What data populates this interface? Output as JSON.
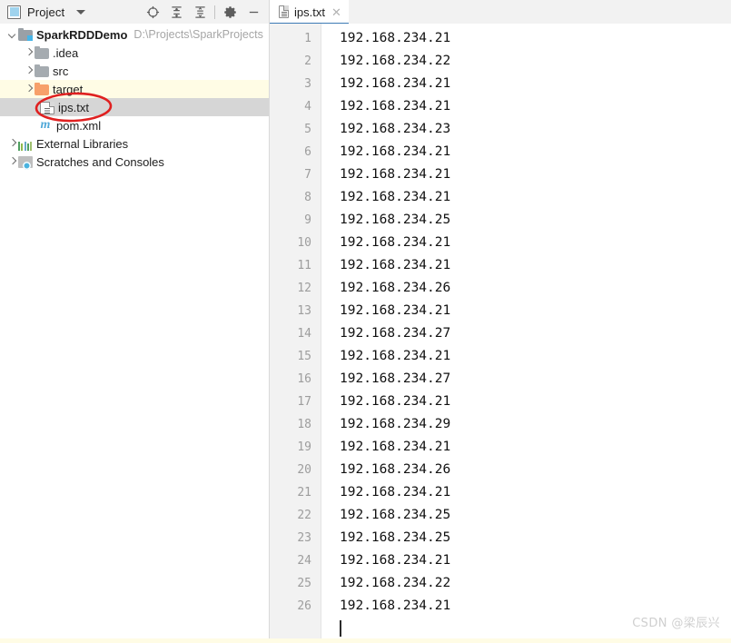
{
  "tool_window": {
    "title": "Project",
    "icon": "project-icon",
    "dropdown_icon": "chevron-down-icon",
    "buttons": [
      {
        "name": "locate-icon",
        "label": "Select Opened File"
      },
      {
        "name": "expand-all-icon",
        "label": "Expand All"
      },
      {
        "name": "collapse-all-icon",
        "label": "Collapse All"
      },
      {
        "name": "settings-gear-icon",
        "label": "Settings"
      },
      {
        "name": "minimize-icon",
        "label": "Hide"
      }
    ]
  },
  "tabs": [
    {
      "label": "ips.txt",
      "icon": "text-file-icon",
      "close_icon": "close-icon",
      "active": true
    }
  ],
  "tree": {
    "nodes": [
      {
        "label": "SparkRDDDemo",
        "path": "D:\\Projects\\SparkProjects",
        "icon": "module-folder-icon",
        "arrow": "down",
        "indent": 0,
        "bold": true,
        "highlight": "none"
      },
      {
        "label": ".idea",
        "path": "",
        "icon": "folder-icon",
        "arrow": "right",
        "indent": 1,
        "bold": false,
        "highlight": "none"
      },
      {
        "label": "src",
        "path": "",
        "icon": "folder-icon",
        "arrow": "right",
        "indent": 1,
        "bold": false,
        "highlight": "none"
      },
      {
        "label": "target",
        "path": "",
        "icon": "folder-orange-icon",
        "arrow": "right",
        "indent": 1,
        "bold": false,
        "highlight": "yellow"
      },
      {
        "label": "ips.txt",
        "path": "",
        "icon": "text-file-icon",
        "arrow": "none",
        "indent": 2,
        "bold": false,
        "highlight": "selected"
      },
      {
        "label": "pom.xml",
        "path": "",
        "icon": "maven-icon",
        "arrow": "none",
        "indent": 2,
        "bold": false,
        "highlight": "none"
      },
      {
        "label": "External Libraries",
        "path": "",
        "icon": "libraries-icon",
        "arrow": "right",
        "indent": 0,
        "bold": false,
        "highlight": "none"
      },
      {
        "label": "Scratches and Consoles",
        "path": "",
        "icon": "scratches-icon",
        "arrow": "right",
        "indent": 0,
        "bold": false,
        "highlight": "none"
      }
    ]
  },
  "annotation": {
    "shape": "ellipse",
    "color": "#e02020",
    "targets": "ips.txt"
  },
  "editor": {
    "file": "ips.txt",
    "line_numbers": [
      1,
      2,
      3,
      4,
      5,
      6,
      7,
      8,
      9,
      10,
      11,
      12,
      13,
      14,
      15,
      16,
      17,
      18,
      19,
      20,
      21,
      22,
      23,
      24,
      25,
      26
    ],
    "lines": [
      "192.168.234.21",
      "192.168.234.22",
      "192.168.234.21",
      "192.168.234.21",
      "192.168.234.23",
      "192.168.234.21",
      "192.168.234.21",
      "192.168.234.21",
      "192.168.234.25",
      "192.168.234.21",
      "192.168.234.21",
      "192.168.234.26",
      "192.168.234.21",
      "192.168.234.27",
      "192.168.234.21",
      "192.168.234.27",
      "192.168.234.21",
      "192.168.234.29",
      "192.168.234.21",
      "192.168.234.26",
      "192.168.234.21",
      "192.168.234.25",
      "192.168.234.25",
      "192.168.234.21",
      "192.168.234.22",
      "192.168.234.21"
    ]
  },
  "watermark": {
    "text": "CSDN @梁辰兴"
  },
  "colors": {
    "accent_tab_underline": "#3d7bb5",
    "selection_gray": "#d6d6d6",
    "highlight_yellow": "#fffce5",
    "annotation_red": "#e02020",
    "gutter_bg": "#f2f2f2"
  }
}
